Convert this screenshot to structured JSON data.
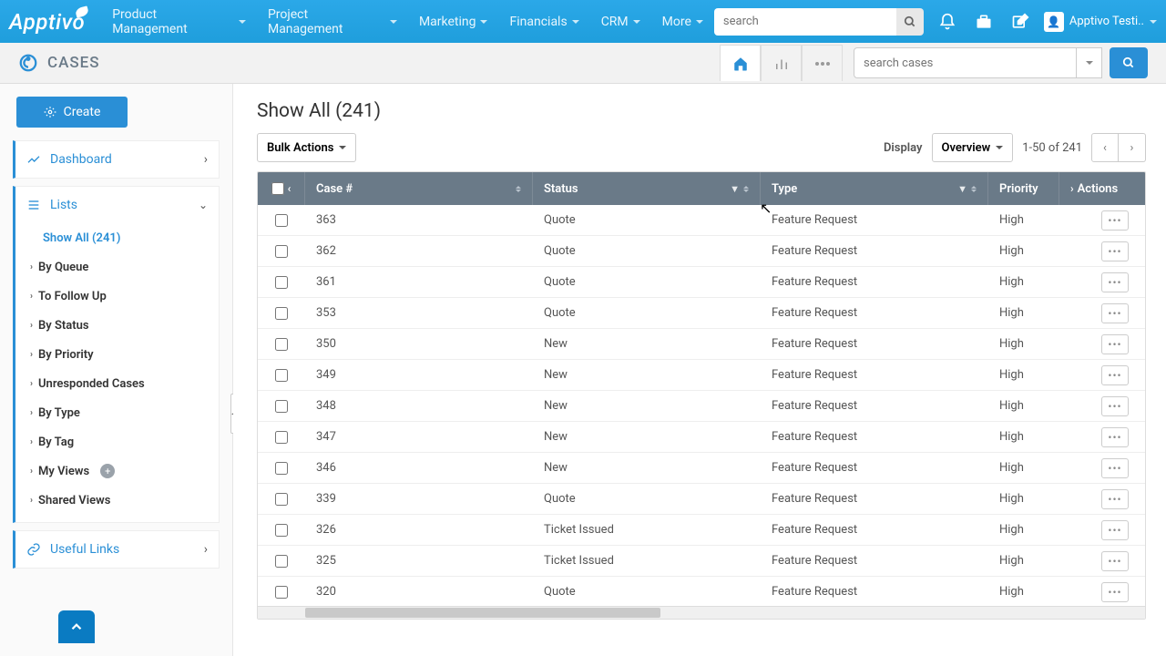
{
  "topnav": {
    "logo": "Apptivo",
    "items": [
      "Product Management",
      "Project Management",
      "Marketing",
      "Financials",
      "CRM",
      "More"
    ],
    "search_placeholder": "search",
    "user": "Apptivo Testi.."
  },
  "subheader": {
    "module": "CASES",
    "search_placeholder": "search cases"
  },
  "sidebar": {
    "create": "Create",
    "dashboard": "Dashboard",
    "lists": "Lists",
    "show_all": "Show All (241)",
    "filters": [
      "By Queue",
      "To Follow Up",
      "By Status",
      "By Priority",
      "Unresponded Cases",
      "By Type",
      "By Tag"
    ],
    "my_views": "My Views",
    "shared_views": "Shared Views",
    "useful_links": "Useful Links"
  },
  "main": {
    "title": "Show All (241)",
    "bulk_actions": "Bulk Actions",
    "display_label": "Display",
    "overview": "Overview",
    "range": "1-50 of 241",
    "columns": {
      "case": "Case #",
      "status": "Status",
      "type": "Type",
      "priority": "Priority",
      "actions": "Actions"
    },
    "rows": [
      {
        "case": "363",
        "status": "Quote",
        "type": "Feature Request",
        "priority": "High"
      },
      {
        "case": "362",
        "status": "Quote",
        "type": "Feature Request",
        "priority": "High"
      },
      {
        "case": "361",
        "status": "Quote",
        "type": "Feature Request",
        "priority": "High"
      },
      {
        "case": "353",
        "status": "Quote",
        "type": "Feature Request",
        "priority": "High"
      },
      {
        "case": "350",
        "status": "New",
        "type": "Feature Request",
        "priority": "High"
      },
      {
        "case": "349",
        "status": "New",
        "type": "Feature Request",
        "priority": "High"
      },
      {
        "case": "348",
        "status": "New",
        "type": "Feature Request",
        "priority": "High"
      },
      {
        "case": "347",
        "status": "New",
        "type": "Feature Request",
        "priority": "High"
      },
      {
        "case": "346",
        "status": "New",
        "type": "Feature Request",
        "priority": "High"
      },
      {
        "case": "339",
        "status": "Quote",
        "type": "Feature Request",
        "priority": "High"
      },
      {
        "case": "326",
        "status": "Ticket Issued",
        "type": "Feature Request",
        "priority": "High"
      },
      {
        "case": "325",
        "status": "Ticket Issued",
        "type": "Feature Request",
        "priority": "High"
      },
      {
        "case": "320",
        "status": "Quote",
        "type": "Feature Request",
        "priority": "High"
      }
    ]
  }
}
